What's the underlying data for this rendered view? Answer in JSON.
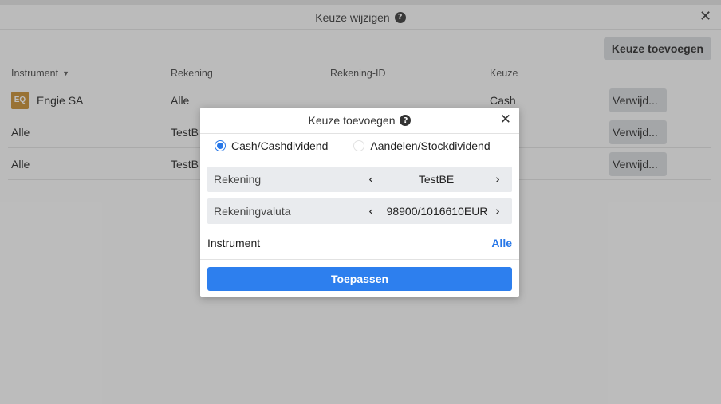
{
  "outer_dialog": {
    "title": "Keuze wijzigen",
    "help_glyph": "?",
    "close_glyph": "✕",
    "add_button": "Keuze toevoegen"
  },
  "table": {
    "headers": {
      "instrument": "Instrument",
      "account": "Rekening",
      "account_id": "Rekening-ID",
      "choice": "Keuze"
    },
    "rows": [
      {
        "badge": "EQ",
        "instrument": "Engie SA",
        "account": "Alle",
        "choice": "Cash",
        "delete": "Verwijd..."
      },
      {
        "badge": "",
        "instrument": "Alle",
        "account": "TestB",
        "choice": "",
        "delete": "Verwijd..."
      },
      {
        "badge": "",
        "instrument": "Alle",
        "account": "TestB",
        "choice": "",
        "delete": "Verwijd..."
      }
    ]
  },
  "modal": {
    "title": "Keuze toevoegen",
    "help_glyph": "?",
    "close_glyph": "✕",
    "radio_cash": "Cash/Cashdividend",
    "radio_stock": "Aandelen/Stockdividend",
    "selected_radio": "cash",
    "account_label": "Rekening",
    "account_value": "TestBE",
    "currency_label": "Rekeningvaluta",
    "currency_value": "98900/1016610EUR",
    "instrument_label": "Instrument",
    "instrument_value": "Alle",
    "apply_button": "Toepassen",
    "chevron_left": "‹",
    "chevron_right": "›"
  },
  "colors": {
    "accent": "#2d7fee",
    "equity_badge": "#c78a2c",
    "button_gray": "#d8dade"
  }
}
